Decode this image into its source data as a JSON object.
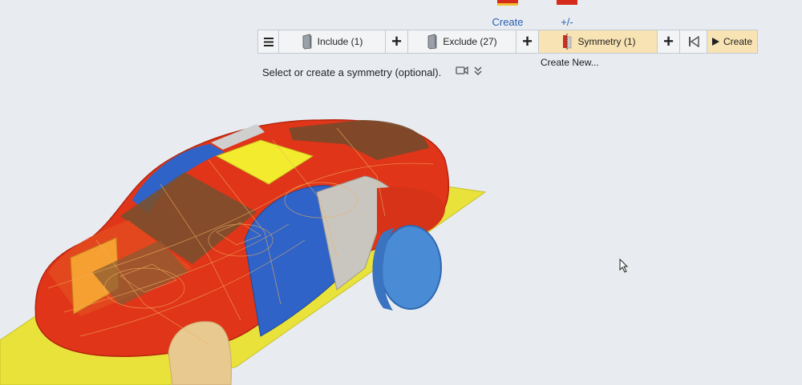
{
  "top_icons": [
    {
      "label": "Create",
      "icon": "create-cube-icon"
    },
    {
      "label": "+/-",
      "icon": "plus-minus-cube-icon"
    }
  ],
  "toolbar": {
    "menu_icon": "hamburger-icon",
    "include_label": "Include (1)",
    "exclude_label": "Exclude (27)",
    "symmetry_label": "Symmetry (1)",
    "create_label": "Create",
    "prev_icon": "skip-back-icon",
    "play_icon": "play-icon"
  },
  "dropdown": {
    "create_new": "Create New..."
  },
  "hint": {
    "text": "Select or create a symmetry (optional)."
  },
  "colors": {
    "body_red": "#e03518",
    "ground_yellow": "#e8e23a",
    "panel_blue": "#2f63c8",
    "wheel_blue": "#4a8bd6",
    "active_tab": "#f7e3b3"
  }
}
